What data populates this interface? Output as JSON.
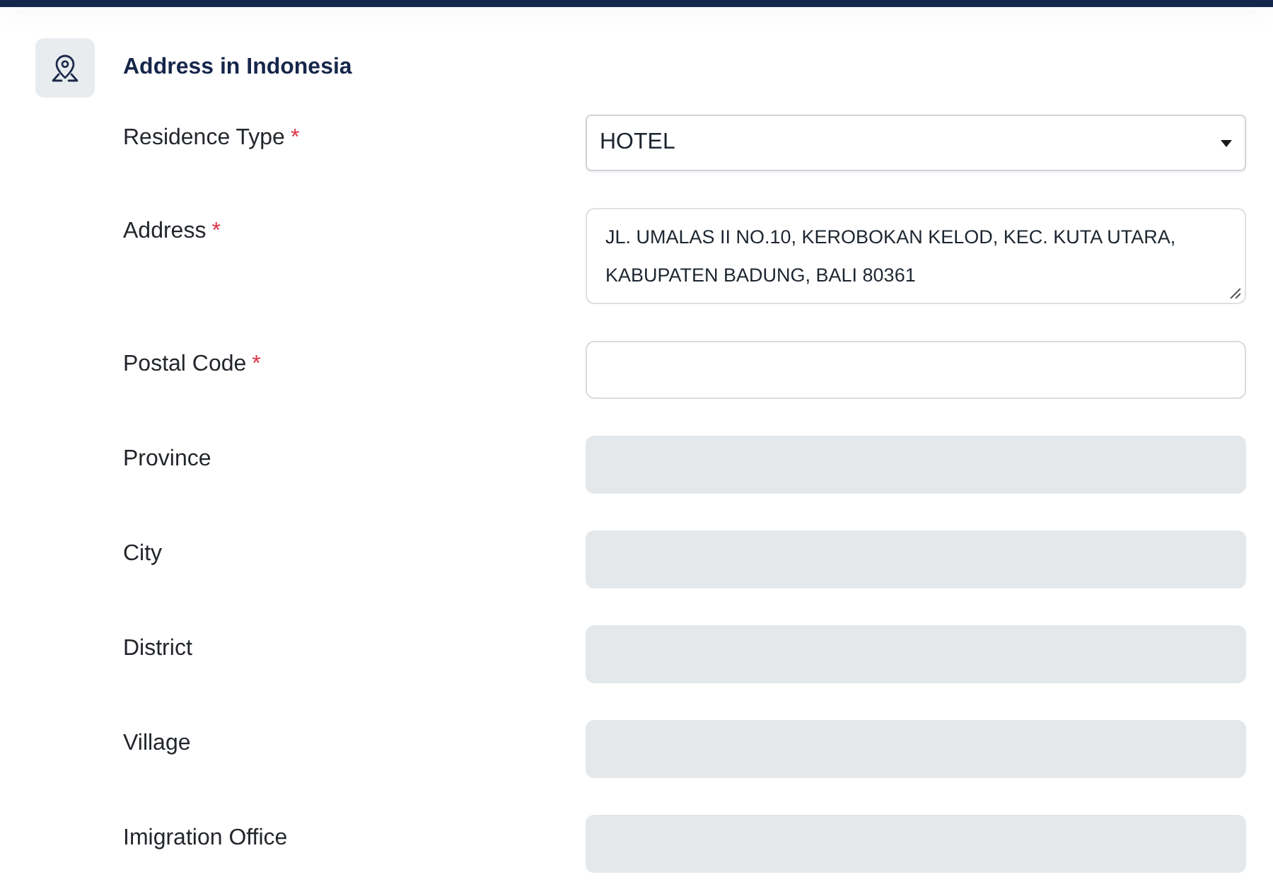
{
  "section": {
    "title": "Address in Indonesia"
  },
  "fields": [
    {
      "label": "Residence Type",
      "required_mark": "*",
      "kind": "select",
      "value": "HOTEL",
      "disabled": false
    },
    {
      "label": "Address",
      "required_mark": "*",
      "kind": "textarea",
      "value": "JL. UMALAS II NO.10, KEROBOKAN KELOD, KEC. KUTA UTARA, KABUPATEN BADUNG, BALI 80361",
      "disabled": false
    },
    {
      "label": "Postal Code",
      "required_mark": "*",
      "kind": "text",
      "disabled": false
    },
    {
      "label": "Province",
      "kind": "text",
      "disabled": true
    },
    {
      "label": "City",
      "kind": "text",
      "disabled": true
    },
    {
      "label": "District",
      "kind": "text",
      "disabled": true
    },
    {
      "label": "Village",
      "kind": "text",
      "disabled": true
    },
    {
      "label": "Imigration Office",
      "kind": "text",
      "disabled": true
    }
  ]
}
